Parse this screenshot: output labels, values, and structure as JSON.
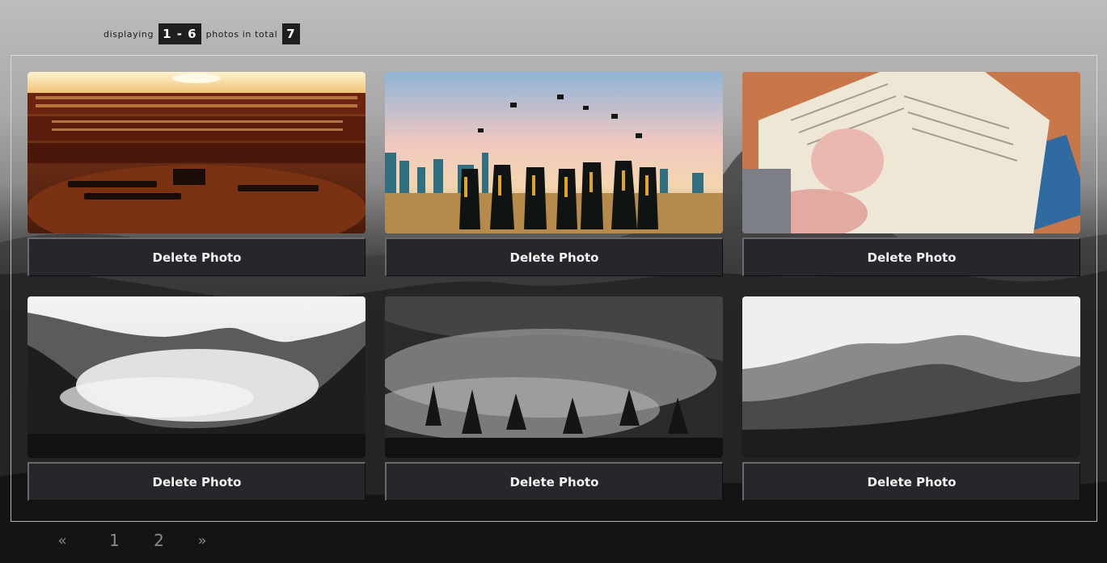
{
  "summary": {
    "prefix": "displaying",
    "range": "1 - 6",
    "middle": "photos in total",
    "total": "7"
  },
  "photos": [
    {
      "name": "photo-library",
      "delete_label": "Delete Photo"
    },
    {
      "name": "photo-graduation",
      "delete_label": "Delete Photo"
    },
    {
      "name": "photo-book",
      "delete_label": "Delete Photo"
    },
    {
      "name": "photo-fog-valley",
      "delete_label": "Delete Photo"
    },
    {
      "name": "photo-misty-forest",
      "delete_label": "Delete Photo"
    },
    {
      "name": "photo-mountains",
      "delete_label": "Delete Photo"
    }
  ],
  "pagination": {
    "prev": "«",
    "pages": [
      "1",
      "2"
    ],
    "next": "»"
  }
}
